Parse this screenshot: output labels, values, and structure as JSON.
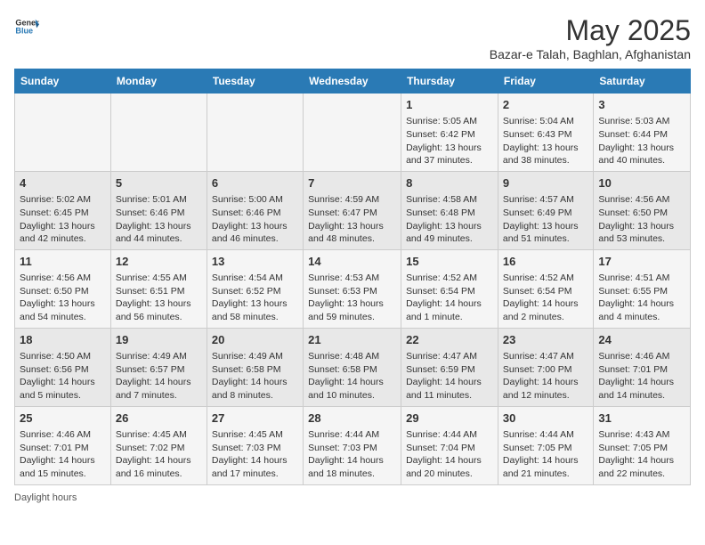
{
  "header": {
    "logo_general": "General",
    "logo_blue": "Blue",
    "month_title": "May 2025",
    "subtitle": "Bazar-e Talah, Baghlan, Afghanistan"
  },
  "days_of_week": [
    "Sunday",
    "Monday",
    "Tuesday",
    "Wednesday",
    "Thursday",
    "Friday",
    "Saturday"
  ],
  "weeks": [
    [
      {
        "day": "",
        "info": ""
      },
      {
        "day": "",
        "info": ""
      },
      {
        "day": "",
        "info": ""
      },
      {
        "day": "",
        "info": ""
      },
      {
        "day": "1",
        "info": "Sunrise: 5:05 AM\nSunset: 6:42 PM\nDaylight: 13 hours and 37 minutes."
      },
      {
        "day": "2",
        "info": "Sunrise: 5:04 AM\nSunset: 6:43 PM\nDaylight: 13 hours and 38 minutes."
      },
      {
        "day": "3",
        "info": "Sunrise: 5:03 AM\nSunset: 6:44 PM\nDaylight: 13 hours and 40 minutes."
      }
    ],
    [
      {
        "day": "4",
        "info": "Sunrise: 5:02 AM\nSunset: 6:45 PM\nDaylight: 13 hours and 42 minutes."
      },
      {
        "day": "5",
        "info": "Sunrise: 5:01 AM\nSunset: 6:46 PM\nDaylight: 13 hours and 44 minutes."
      },
      {
        "day": "6",
        "info": "Sunrise: 5:00 AM\nSunset: 6:46 PM\nDaylight: 13 hours and 46 minutes."
      },
      {
        "day": "7",
        "info": "Sunrise: 4:59 AM\nSunset: 6:47 PM\nDaylight: 13 hours and 48 minutes."
      },
      {
        "day": "8",
        "info": "Sunrise: 4:58 AM\nSunset: 6:48 PM\nDaylight: 13 hours and 49 minutes."
      },
      {
        "day": "9",
        "info": "Sunrise: 4:57 AM\nSunset: 6:49 PM\nDaylight: 13 hours and 51 minutes."
      },
      {
        "day": "10",
        "info": "Sunrise: 4:56 AM\nSunset: 6:50 PM\nDaylight: 13 hours and 53 minutes."
      }
    ],
    [
      {
        "day": "11",
        "info": "Sunrise: 4:56 AM\nSunset: 6:50 PM\nDaylight: 13 hours and 54 minutes."
      },
      {
        "day": "12",
        "info": "Sunrise: 4:55 AM\nSunset: 6:51 PM\nDaylight: 13 hours and 56 minutes."
      },
      {
        "day": "13",
        "info": "Sunrise: 4:54 AM\nSunset: 6:52 PM\nDaylight: 13 hours and 58 minutes."
      },
      {
        "day": "14",
        "info": "Sunrise: 4:53 AM\nSunset: 6:53 PM\nDaylight: 13 hours and 59 minutes."
      },
      {
        "day": "15",
        "info": "Sunrise: 4:52 AM\nSunset: 6:54 PM\nDaylight: 14 hours and 1 minute."
      },
      {
        "day": "16",
        "info": "Sunrise: 4:52 AM\nSunset: 6:54 PM\nDaylight: 14 hours and 2 minutes."
      },
      {
        "day": "17",
        "info": "Sunrise: 4:51 AM\nSunset: 6:55 PM\nDaylight: 14 hours and 4 minutes."
      }
    ],
    [
      {
        "day": "18",
        "info": "Sunrise: 4:50 AM\nSunset: 6:56 PM\nDaylight: 14 hours and 5 minutes."
      },
      {
        "day": "19",
        "info": "Sunrise: 4:49 AM\nSunset: 6:57 PM\nDaylight: 14 hours and 7 minutes."
      },
      {
        "day": "20",
        "info": "Sunrise: 4:49 AM\nSunset: 6:58 PM\nDaylight: 14 hours and 8 minutes."
      },
      {
        "day": "21",
        "info": "Sunrise: 4:48 AM\nSunset: 6:58 PM\nDaylight: 14 hours and 10 minutes."
      },
      {
        "day": "22",
        "info": "Sunrise: 4:47 AM\nSunset: 6:59 PM\nDaylight: 14 hours and 11 minutes."
      },
      {
        "day": "23",
        "info": "Sunrise: 4:47 AM\nSunset: 7:00 PM\nDaylight: 14 hours and 12 minutes."
      },
      {
        "day": "24",
        "info": "Sunrise: 4:46 AM\nSunset: 7:01 PM\nDaylight: 14 hours and 14 minutes."
      }
    ],
    [
      {
        "day": "25",
        "info": "Sunrise: 4:46 AM\nSunset: 7:01 PM\nDaylight: 14 hours and 15 minutes."
      },
      {
        "day": "26",
        "info": "Sunrise: 4:45 AM\nSunset: 7:02 PM\nDaylight: 14 hours and 16 minutes."
      },
      {
        "day": "27",
        "info": "Sunrise: 4:45 AM\nSunset: 7:03 PM\nDaylight: 14 hours and 17 minutes."
      },
      {
        "day": "28",
        "info": "Sunrise: 4:44 AM\nSunset: 7:03 PM\nDaylight: 14 hours and 18 minutes."
      },
      {
        "day": "29",
        "info": "Sunrise: 4:44 AM\nSunset: 7:04 PM\nDaylight: 14 hours and 20 minutes."
      },
      {
        "day": "30",
        "info": "Sunrise: 4:44 AM\nSunset: 7:05 PM\nDaylight: 14 hours and 21 minutes."
      },
      {
        "day": "31",
        "info": "Sunrise: 4:43 AM\nSunset: 7:05 PM\nDaylight: 14 hours and 22 minutes."
      }
    ]
  ],
  "footer": {
    "daylight_label": "Daylight hours"
  }
}
